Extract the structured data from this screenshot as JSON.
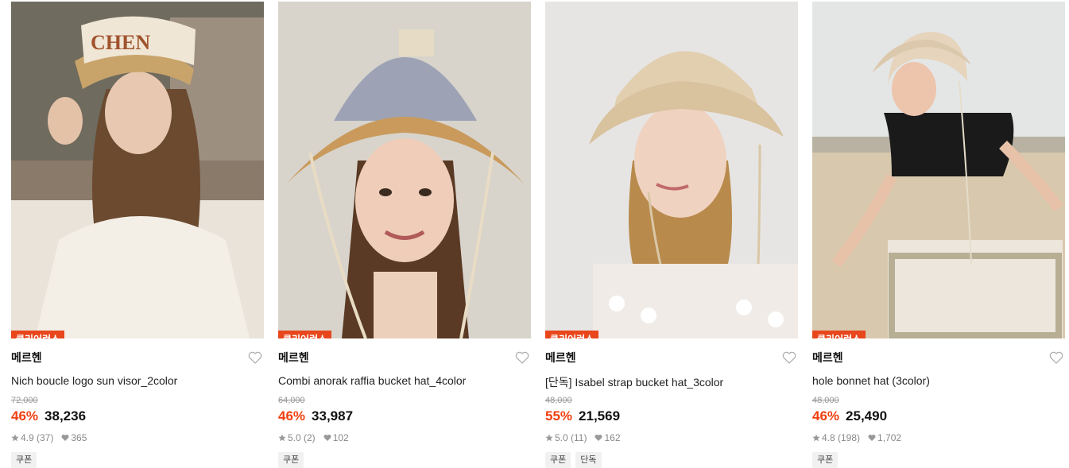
{
  "colors": {
    "badge": "#e8461c",
    "discount": "#f0400f",
    "strike": "#999999",
    "tag_bg": "#f1f1f1"
  },
  "products": [
    {
      "badge": "클리어런스",
      "brand": "메르헨",
      "name": "Nich boucle logo sun visor_2color",
      "original_price": "72,000",
      "discount": "46%",
      "price": "38,236",
      "rating": "4.9 (37)",
      "likes": "365",
      "tags": [
        "쿠폰"
      ],
      "visor_text": "CHEN"
    },
    {
      "badge": "클리어런스",
      "brand": "메르헨",
      "name": "Combi anorak raffia bucket hat_4color",
      "original_price": "64,000",
      "discount": "46%",
      "price": "33,987",
      "rating": "5.0 (2)",
      "likes": "102",
      "tags": [
        "쿠폰"
      ]
    },
    {
      "badge": "클리어런스",
      "brand": "메르헨",
      "name": "[단독] Isabel strap bucket hat_3color",
      "original_price": "48,000",
      "discount": "55%",
      "price": "21,569",
      "rating": "5.0 (11)",
      "likes": "162",
      "tags": [
        "쿠폰",
        "단독"
      ]
    },
    {
      "badge": "클리어런스",
      "brand": "메르헨",
      "name": "hole bonnet hat (3color)",
      "original_price": "48,000",
      "discount": "46%",
      "price": "25,490",
      "rating": "4.8 (198)",
      "likes": "1,702",
      "tags": [
        "쿠폰"
      ]
    }
  ]
}
